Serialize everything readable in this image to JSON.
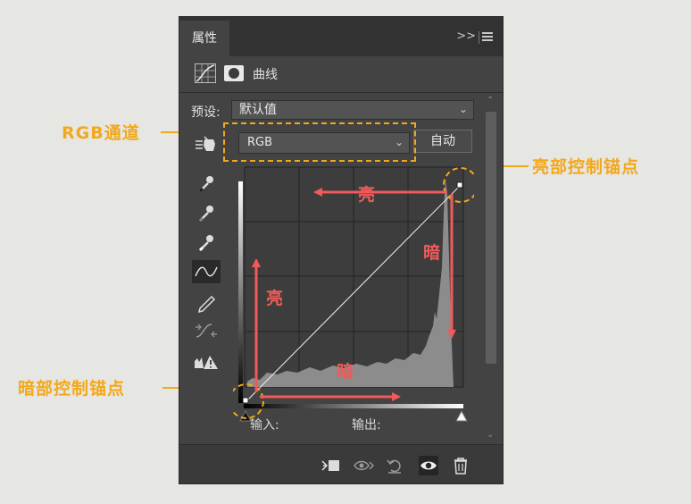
{
  "panel": {
    "tab": "属性",
    "collapse_icon": "double-chevron-right-icon",
    "menu_icon": "panel-menu-icon",
    "title": "曲线",
    "preset_label": "预设:",
    "preset_value": "默认值",
    "channel_value": "RGB",
    "auto_label": "自动",
    "input_label": "输入:",
    "output_label": "输出:"
  },
  "annotations": {
    "rgb_channel": "RGB通道",
    "highlight_anchor": "亮部控制锚点",
    "shadow_anchor": "暗部控制锚点",
    "bright_top": "亮",
    "dark_right": "暗",
    "bright_left": "亮",
    "dark_bottom": "暗",
    "accent_color": "#f3a81b",
    "arrow_color": "#f05a5a"
  },
  "tools": [
    "on-image-adjust-icon",
    "black-point-eyedropper-icon",
    "gray-point-eyedropper-icon",
    "white-point-eyedropper-icon",
    "curve-points-icon",
    "pencil-icon",
    "smooth-icon",
    "clipping-warning-icon"
  ],
  "bottom_icons": [
    "clip-to-layer-icon",
    "view-previous-icon",
    "reset-icon",
    "visibility-icon",
    "delete-icon"
  ]
}
